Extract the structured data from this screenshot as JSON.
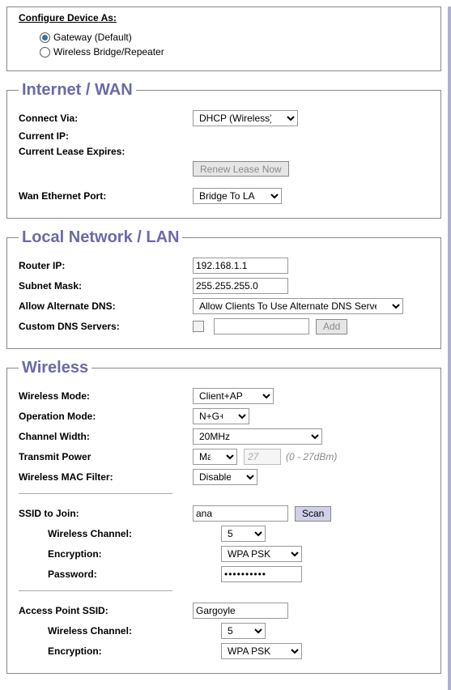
{
  "configure": {
    "title": "Configure Device As:",
    "options": [
      {
        "label": "Gateway (Default)",
        "selected": true
      },
      {
        "label": "Wireless Bridge/Repeater",
        "selected": false
      }
    ]
  },
  "wan": {
    "legend": "Internet / WAN",
    "connect_via_label": "Connect Via:",
    "connect_via_value": "DHCP (Wireless)",
    "current_ip_label": "Current IP:",
    "current_ip_value": "",
    "lease_expires_label": "Current Lease Expires:",
    "lease_expires_value": "",
    "renew_button": "Renew Lease Now",
    "eth_port_label": "Wan Ethernet Port:",
    "eth_port_value": "Bridge To LAN"
  },
  "lan": {
    "legend": "Local Network / LAN",
    "router_ip_label": "Router IP:",
    "router_ip_value": "192.168.1.1",
    "subnet_label": "Subnet Mask:",
    "subnet_value": "255.255.255.0",
    "alt_dns_label": "Allow Alternate DNS:",
    "alt_dns_value": "Allow Clients To Use Alternate DNS Servers",
    "custom_dns_label": "Custom DNS Servers:",
    "custom_dns_value": "",
    "add_button": "Add"
  },
  "wireless": {
    "legend": "Wireless",
    "mode_label": "Wireless Mode:",
    "mode_value": "Client+AP",
    "op_label": "Operation Mode:",
    "op_value": "N+G+B",
    "chwidth_label": "Channel Width:",
    "chwidth_value": "20MHz",
    "tx_label": "Transmit Power",
    "tx_value": "Max",
    "tx_dbm_placeholder": "27",
    "tx_hint": "(0 - 27dBm)",
    "mac_label": "Wireless MAC Filter:",
    "mac_value": "Disabled",
    "ssid_join_label": "SSID to Join:",
    "ssid_join_value": "ana",
    "scan_button": "Scan",
    "ch_label": "Wireless Channel:",
    "ch_value_client": "5",
    "enc_label": "Encryption:",
    "enc_value_client": "WPA PSK",
    "pw_label": "Password:",
    "pw_value": "••••••••••",
    "ap_ssid_label": "Access Point SSID:",
    "ap_ssid_value": "Gargoyle",
    "ch_value_ap": "5",
    "enc_value_ap": "WPA PSK"
  }
}
